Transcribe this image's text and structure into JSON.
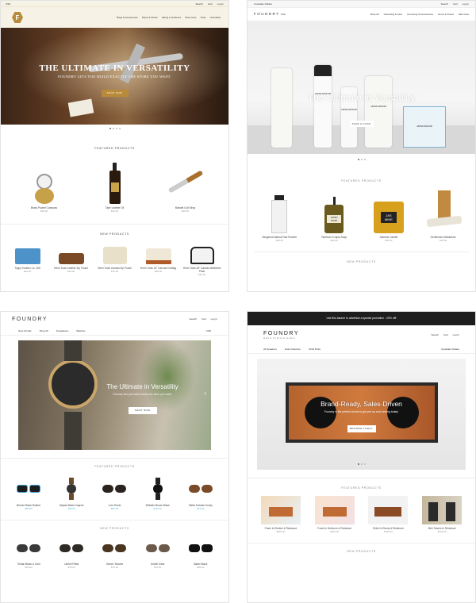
{
  "p1": {
    "top_left": "USD",
    "top_right": [
      "Search",
      "Cart",
      "Log In"
    ],
    "logo_letter": "F",
    "nav": [
      "Bags & Accessories",
      "Pants & Shorts",
      "Hiking & Outdoors",
      "Shoe Care",
      "Tools",
      "Umbrellas"
    ],
    "hero_title": "THE ULTIMATE IN VERSATILITY",
    "hero_sub": "FOUNDRY LETS YOU BUILD EXACTLY THE STORE YOU WANT.",
    "hero_btn": "SHOP NOW",
    "featured_title": "FEATURED PRODUCTS",
    "featured": [
      {
        "name": "Brass Pocket Compass",
        "price": "$48.00"
      },
      {
        "name": "Tajer Leather Oil",
        "price": "$12.00"
      },
      {
        "name": "Mahatit Colt Strop",
        "price": "$28.00"
      }
    ],
    "new_title": "NEW PRODUCTS",
    "new": [
      {
        "name": "Trippy Toolbox Co. 2MI",
        "price": "$22.00"
      },
      {
        "name": "Hmm Tools Leather Zip Pouch",
        "price": "$18.00"
      },
      {
        "name": "Hmm Tools Canvas Zip Pouch",
        "price": "$14.00"
      },
      {
        "name": "Hmm Tools 16\" Canvas Toolbag",
        "price": "$38.00"
      },
      {
        "name": "Hmm Tools 18\" Canvas Weekend Pack",
        "price": "$42.00"
      }
    ]
  },
  "p2": {
    "top_left": "Canadian Dollars",
    "top_right": [
      "Search",
      "Cart",
      "Log In"
    ],
    "logo": "FOUNDRY",
    "logo_sub": "USA",
    "nav": [
      "Shop All",
      "Cleansing & Care",
      "Grooming & Accessories",
      "Home & Travel",
      "Skin Care"
    ],
    "hero_title": "The Ultimate in Versatility",
    "hero_btn": "TAKE A LOOK",
    "jar_labels": [
      "URSA MAJOR",
      "URSA MAJOR",
      "URSA MAJOR",
      "URSA MAJOR"
    ],
    "featured_title": "FEATURED PRODUCTS",
    "featured": [
      {
        "name": "Bergamot Natural Hair Powder",
        "price": "$18.00"
      },
      {
        "name": "Harrison's Liquid Soap",
        "price": "$24.00"
      },
      {
        "name": "Jasmine Candle",
        "price": "$36.00"
      },
      {
        "name": "Gentlemen Moisturizer",
        "price": "$16.00"
      }
    ],
    "bottle_labels": [
      "HAND SOAP",
      "JAS MINE"
    ],
    "new_title": "NEW PRODUCTS"
  },
  "p3": {
    "logo": "FOUNDRY",
    "top_right": [
      "Search",
      "Cart",
      "Log In"
    ],
    "nav": [
      "New Arrivals",
      "Shop All",
      "Sunglasses",
      "Watches"
    ],
    "currency": "USD",
    "hero_title": "The Ultimate in Versatility",
    "hero_sub": "Foundry lets you build exactly the store you want.",
    "hero_btn": "SHOP NOW",
    "featured_title": "FEATURED PRODUCTS",
    "featured": [
      {
        "name": "Breeze Black Rubber",
        "price": "$80.00"
      },
      {
        "name": "Mojave Black Caprice",
        "price": "$90.00"
      },
      {
        "name": "Lulu Finest",
        "price": "$60.00"
      },
      {
        "name": "Whistler Brown Black",
        "price": "$110.00"
      },
      {
        "name": "Stella Tortoise Honey",
        "price": "$75.00"
      }
    ],
    "new_title": "NEW PRODUCTS",
    "new": [
      {
        "name": "Tristan Black & Gold",
        "price": "$80.00"
      },
      {
        "name": "Umbel Fitted",
        "price": "$70.00"
      },
      {
        "name": "Venice Tortoise",
        "price": "$75.00"
      },
      {
        "name": "Umbel Clear",
        "price": "$70.00"
      },
      {
        "name": "Baker Black",
        "price": "$85.00"
      }
    ]
  },
  "p4": {
    "banner": "Use this banner to advertise a special promotion - 20% off!",
    "logo": "FOUNDRY",
    "tagline": "Hand Crafted Audio",
    "top_right": [
      "Search",
      "Cart",
      "Log In"
    ],
    "nav": [
      "All Speakers",
      "Dual Collection",
      "Shelf Picks"
    ],
    "currency": "Canadian Dollars",
    "hero_title": "Brand-Ready, Sales-Driven",
    "hero_sub": "Foundry is the perfect choice to get you up and running today!",
    "hero_btn": "BROWSE TODAY",
    "featured_title": "FEATURED PRODUCTS",
    "featured": [
      {
        "name": "Foam In Electric & Redwood",
        "price": "$235.00"
      },
      {
        "name": "Foam In Heirloom & Redwood",
        "price": "$220.00"
      },
      {
        "name": "Elder In Ebony & Redwood",
        "price": "$199.00"
      },
      {
        "name": "Mini Towers In Redwood",
        "price": "$160.00"
      }
    ],
    "new_title": "NEW PRODUCTS"
  },
  "colors": {
    "gold": "#b98a3a",
    "mustard": "#c9a24a",
    "blue": "#58b7d6",
    "dark": "#1d1d1d",
    "wood": "#b5642f"
  }
}
